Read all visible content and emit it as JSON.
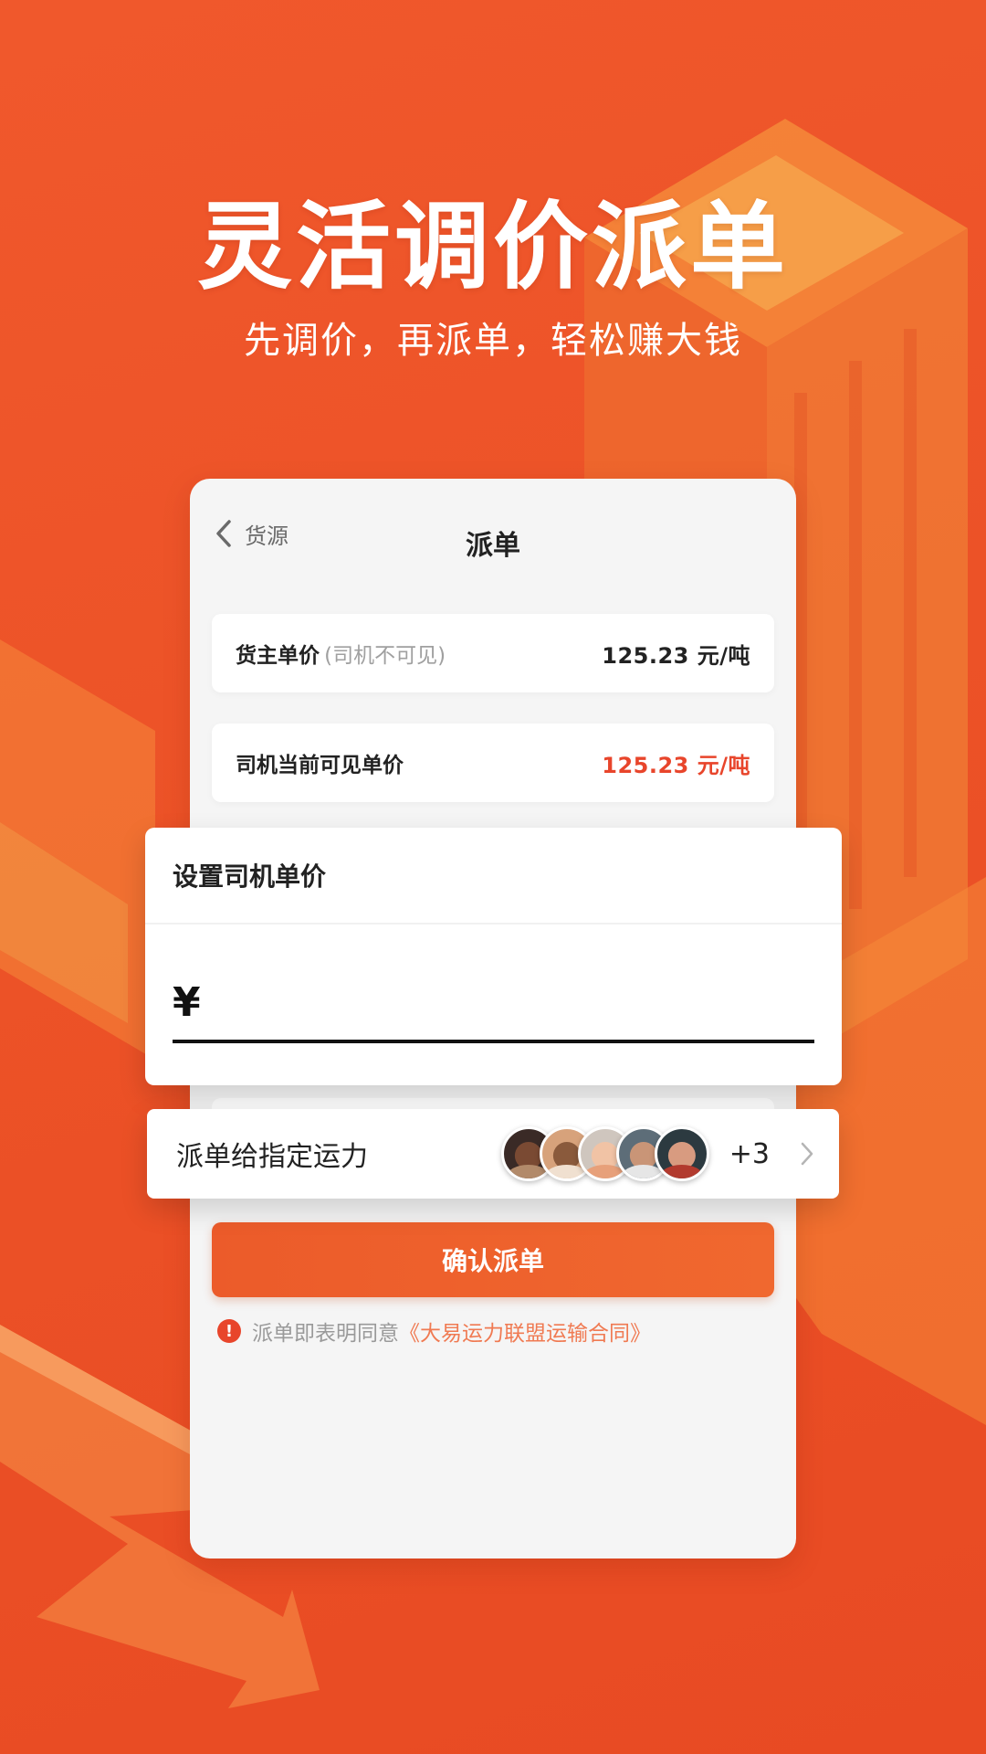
{
  "hero": {
    "title": "灵活调价派单",
    "subtitle": "先调价，再派单，轻松赚大钱"
  },
  "nav": {
    "back_label": "货源",
    "title": "派单"
  },
  "rows": {
    "owner_price_label": "货主单价",
    "owner_price_note": "(司机不可见)",
    "owner_price_value": "125.23 元/吨",
    "driver_price_label": "司机当前可见单价",
    "driver_price_value": "125.23 元/吨"
  },
  "price_popup": {
    "title": "设置司机单价",
    "currency": "¥",
    "input_value": ""
  },
  "capacity": {
    "label": "派单给指定运力",
    "more_count": "+3",
    "avatars": [
      "avatar-1",
      "avatar-2",
      "avatar-3",
      "avatar-4",
      "avatar-5"
    ]
  },
  "actions": {
    "confirm_label": "确认派单"
  },
  "agreement": {
    "prefix": "派单即表明同意",
    "link": "《大易运力联盟运输合同》"
  },
  "colors": {
    "background": "#ec5227",
    "accent_red": "#e8452b",
    "button": "#ec5b2a",
    "link": "#f07a52"
  },
  "icons": {
    "back": "chevron-left-icon",
    "warning": "exclamation-circle-icon",
    "forward": "chevron-right-icon"
  }
}
